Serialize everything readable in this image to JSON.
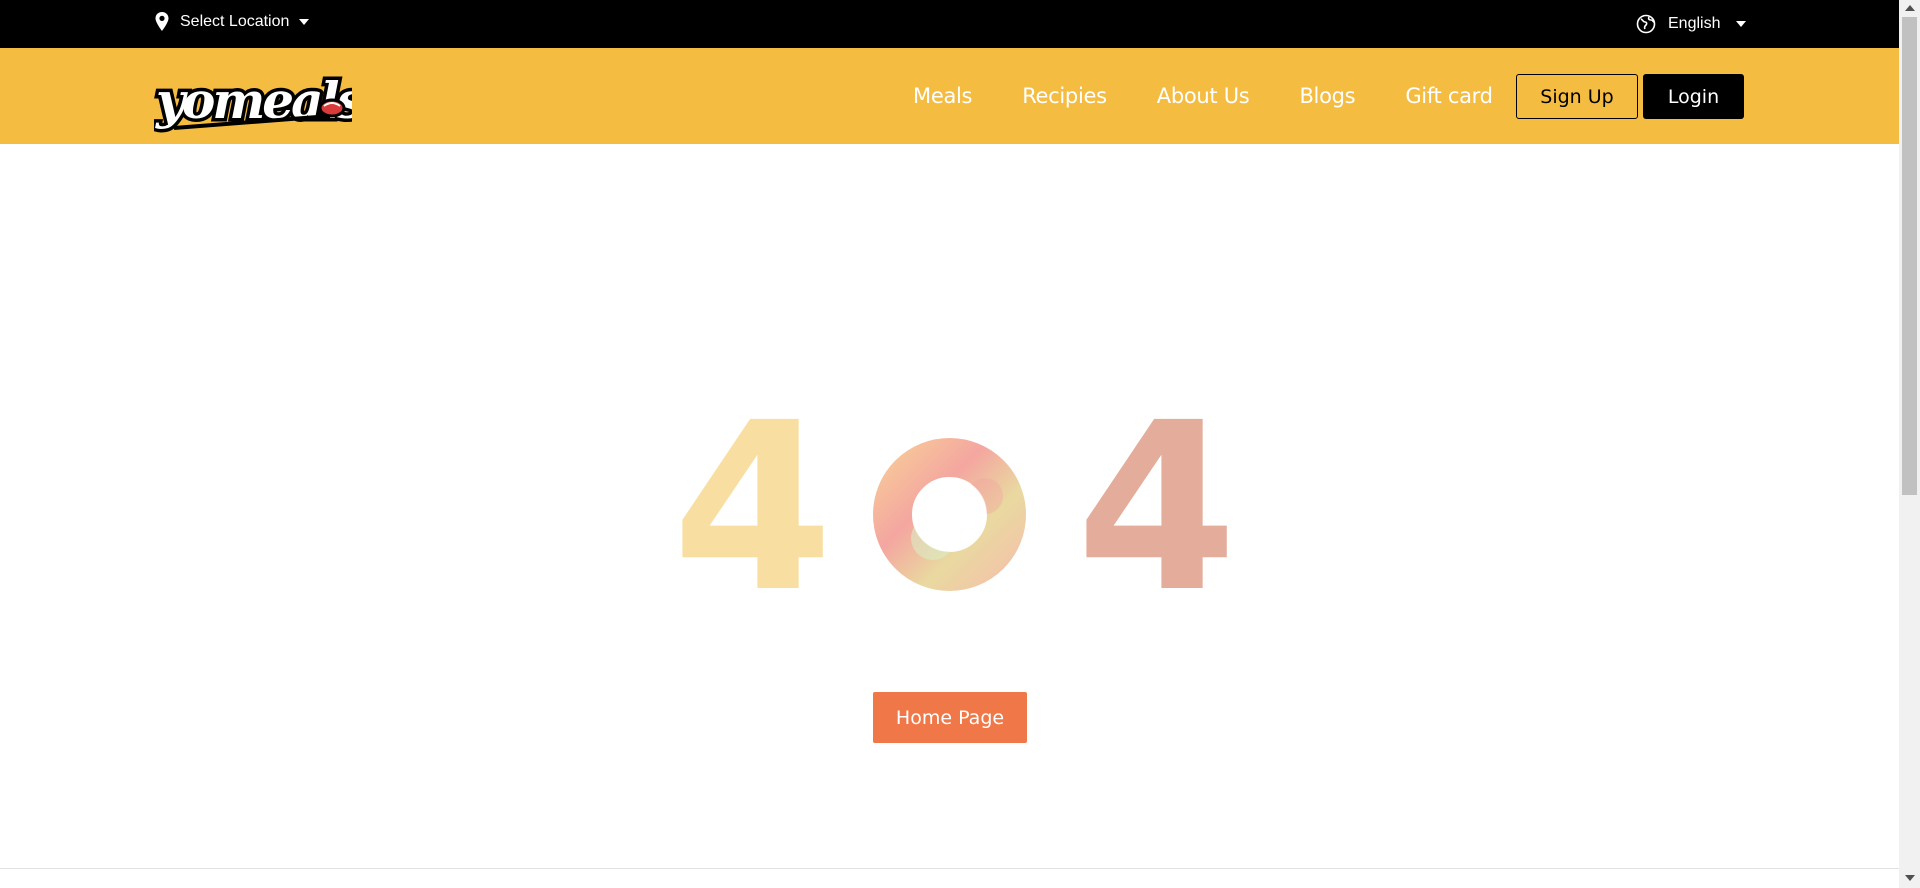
{
  "topbar": {
    "location_label": "Select Location",
    "location_icon": "map-pin-icon",
    "language_label": "English",
    "language_icon": "globe-icon"
  },
  "header": {
    "logo_text": "yomeals",
    "nav": [
      "Meals",
      "Recipies",
      "About Us",
      "Blogs",
      "Gift card"
    ],
    "signup_label": "Sign Up",
    "login_label": "Login"
  },
  "error": {
    "code_left": "4",
    "code_middle": "0",
    "code_right": "4",
    "home_button_label": "Home Page"
  },
  "colors": {
    "topbar_bg": "#000000",
    "header_bg": "#f5bc42",
    "home_button_bg": "#f07747",
    "four_left": "#f8dea0",
    "four_right": "#e4ac9a"
  }
}
